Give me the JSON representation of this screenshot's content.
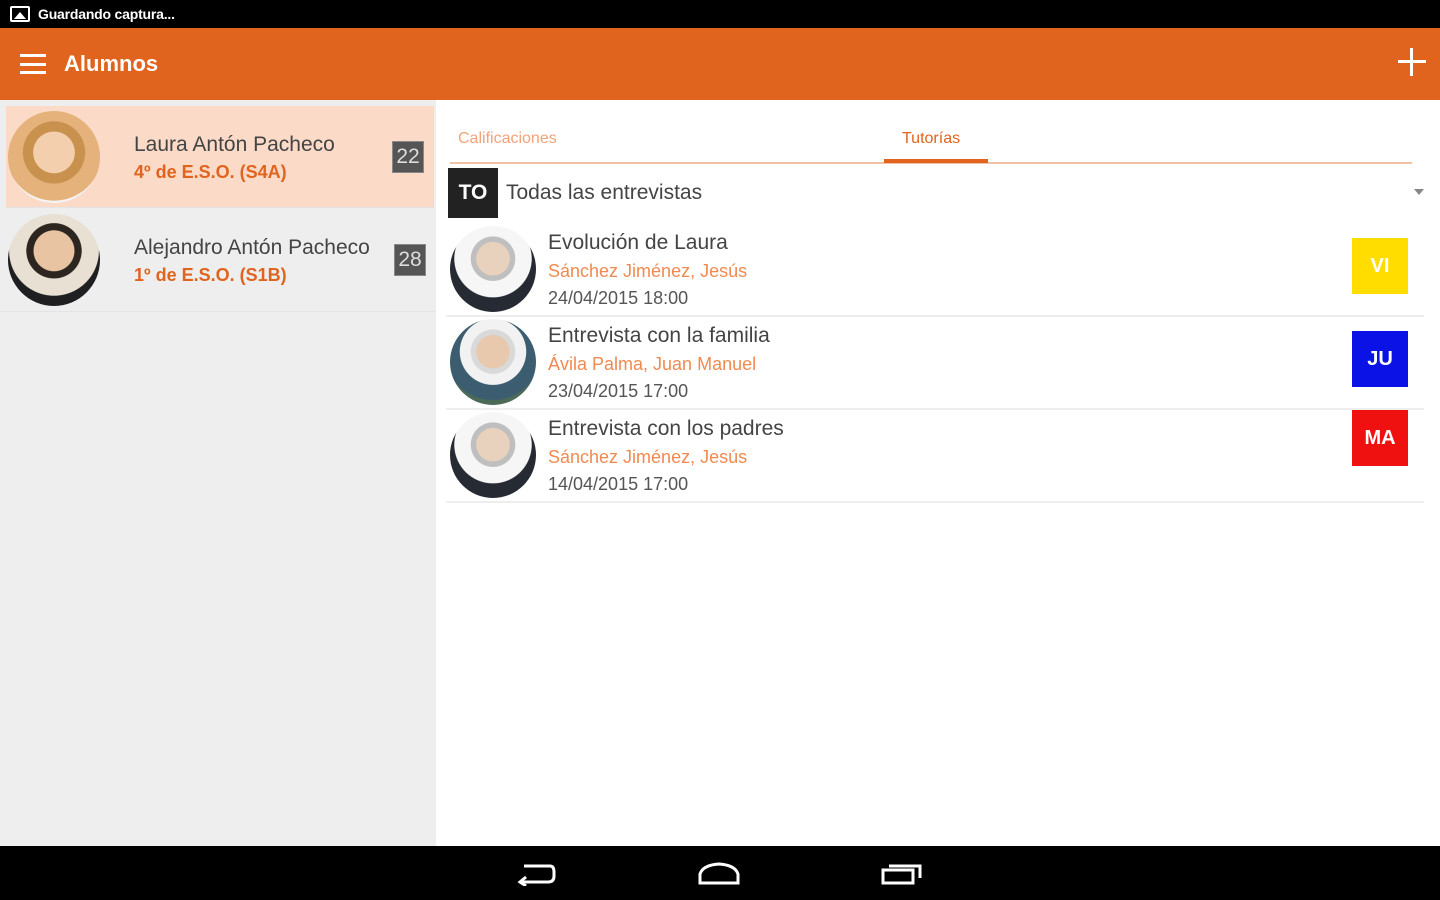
{
  "status_bar": {
    "text": "Guardando captura..."
  },
  "app_bar": {
    "title": "Alumnos"
  },
  "students": [
    {
      "name": "Laura Antón Pacheco",
      "course": "4º de E.S.O. (S4A)",
      "badge": "22"
    },
    {
      "name": "Alejandro Antón Pacheco",
      "course": "1º de E.S.O. (S1B)",
      "badge": "28"
    }
  ],
  "tabs": [
    {
      "label": "Calificaciones"
    },
    {
      "label": "Tutorías"
    }
  ],
  "filter": {
    "abbr": "TO",
    "label": "Todas las entrevistas"
  },
  "interviews": [
    {
      "title": "Evolución de Laura",
      "teacher": "Sánchez  Jiménez, Jesús",
      "date": "24/04/2015 18:00",
      "day": "VI",
      "day_color": "#ffdd00"
    },
    {
      "title": "Entrevista con la familia",
      "teacher": "Ávila Palma, Juan Manuel",
      "date": "23/04/2015 17:00",
      "day": "JU",
      "day_color": "#0a12e6"
    },
    {
      "title": "Entrevista con los padres",
      "teacher": "Sánchez  Jiménez, Jesús",
      "date": "14/04/2015 17:00",
      "day": "MA",
      "day_color": "#ef1010"
    }
  ],
  "colors": {
    "accent": "#e0641e",
    "selected_row": "#fbdac7"
  }
}
